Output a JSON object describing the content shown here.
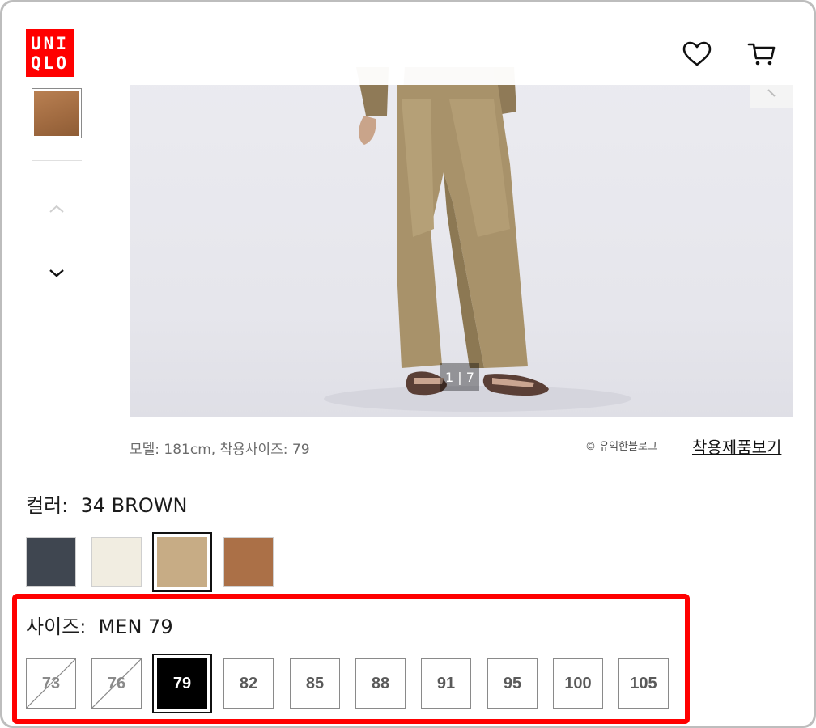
{
  "header": {
    "logo_line1": "UNI",
    "logo_line2": "QLO",
    "wishlist_icon": "heart-icon",
    "cart_icon": "cart-icon"
  },
  "gallery": {
    "counter": "1 | 7"
  },
  "caption": {
    "model_info": "모델: 181cm, 착용사이즈: 79",
    "copyright": "© 유익한블로그",
    "worn_products_link": "착용제품보기"
  },
  "color": {
    "label": "컬러:",
    "selected": "34 BROWN",
    "swatches": [
      {
        "hex": "#3f4650",
        "selected": false
      },
      {
        "hex": "#f1ede1",
        "selected": false
      },
      {
        "hex": "#c7ac85",
        "selected": true
      },
      {
        "hex": "#ab7047",
        "selected": false
      }
    ]
  },
  "size": {
    "label": "사이즈:",
    "selected": "MEN 79",
    "options": [
      {
        "label": "73",
        "available": false,
        "selected": false
      },
      {
        "label": "76",
        "available": false,
        "selected": false
      },
      {
        "label": "79",
        "available": true,
        "selected": true
      },
      {
        "label": "82",
        "available": true,
        "selected": false
      },
      {
        "label": "85",
        "available": true,
        "selected": false
      },
      {
        "label": "88",
        "available": true,
        "selected": false
      },
      {
        "label": "91",
        "available": true,
        "selected": false
      },
      {
        "label": "95",
        "available": true,
        "selected": false
      },
      {
        "label": "100",
        "available": true,
        "selected": false
      },
      {
        "label": "105",
        "available": true,
        "selected": false
      }
    ]
  },
  "colors": {
    "brand_red": "#ff0000",
    "highlight_red": "#ff0000"
  }
}
